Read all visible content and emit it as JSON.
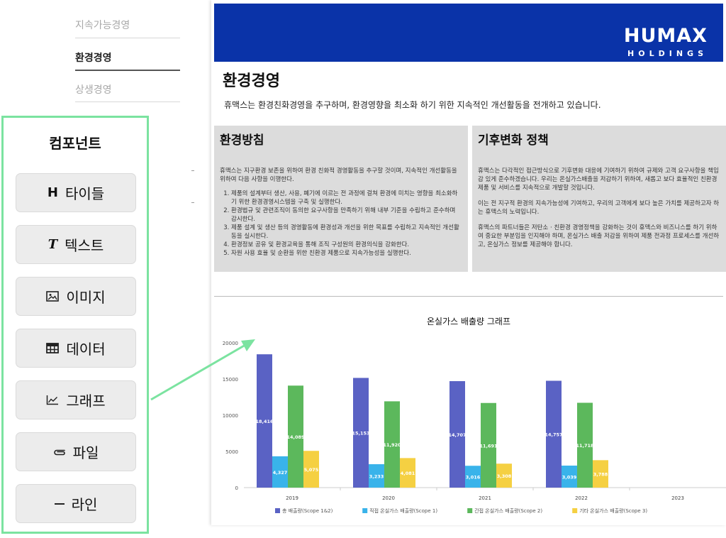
{
  "nav": {
    "items": [
      {
        "label": "지속가능경영",
        "active": false
      },
      {
        "label": "환경경영",
        "active": true
      },
      {
        "label": "상생경영",
        "active": false
      }
    ]
  },
  "components": {
    "title": "컴포넌트",
    "buttons": [
      {
        "icon": "heading-icon",
        "glyph": "H",
        "label": "타이들"
      },
      {
        "icon": "text-icon",
        "glyph": "T",
        "label": "텍스트"
      },
      {
        "icon": "image-icon",
        "glyph": "",
        "label": "이미지"
      },
      {
        "icon": "table-icon",
        "glyph": "",
        "label": "데이터"
      },
      {
        "icon": "line-chart-icon",
        "glyph": "",
        "label": "그래프"
      },
      {
        "icon": "paperclip-icon",
        "glyph": "",
        "label": "파일"
      },
      {
        "icon": "minus-icon",
        "glyph": "—",
        "label": "라인"
      }
    ]
  },
  "doc": {
    "logo_main": "HUMAX",
    "logo_sub": "HOLDINGS",
    "title": "환경경영",
    "intro": "휴맥스는 환경친화경영을 추구하며, 환경영향을 최소화 하기 위한 지속적인 개선활동을 전개하고 있습니다.",
    "left_box": {
      "title": "환경방침",
      "lead": "휴맥스는 지구환경 보존을 위하여 환경 친화적 경영활동을 추구할 것이며, 지속적인 개선활동을 위하여 다음 사항을 이행한다.",
      "items": [
        "제품의 설계부터 생산, 사용, 폐기에 이르는 전 과정에 걸쳐 환경에 미치는 영향을 최소화하기 위한 환경경영시스템을 구축 및 실행한다.",
        "환경법규 및 관련조직이 동의한 요구사항을 만족하기 위해 내부 기준을 수립하고 준수하며 감시한다.",
        "제품 설계 및 생산 등의 경영활동에 환경성과 개선을 위한 목표를 수립하고 지속적인 개선활동을 실시한다.",
        "환경정보 공유 및 환경교육을 통해 조직 구성원의 환경의식을 강화한다.",
        "자원 사용 효율 및 순환을 위한 친환경 제품으로 지속가능성을 실행한다."
      ]
    },
    "right_box": {
      "title": "기후변화 정책",
      "p1": "휴맥스는 다각적인 접근방식으로 기후변화 대응에 기여하기 위하여 규제와 고객 요구사항을 책임감 있게 준수하겠습니다. 우리는 온실가스배출을 저감하기 위하여, 새롭고 보다 효율적인 친환경 제품 및 서비스를 지속적으로 개발할 것입니다.",
      "p2": "이는 전 지구적 환경의 지속가능성에 기여하고, 우리의 고객에게 보다 높은 가치를 제공하고자 하는 휴맥스의 노력입니다.",
      "p3": "휴맥스의 파트너들은 저탄소 · 친환경 경영정책을 강화하는 것이 휴맥스와 비즈니스를 하기 위하여 중요한 부분임을 인지해야 하며, 온실가스 배출 저감을 위하여 제품 전과정 프로세스를 개선하고, 온실가스 정보를 제공해야 합니다."
    }
  },
  "chart_data": {
    "type": "bar",
    "title": "온실가스 배출량 그래프",
    "categories": [
      "2019",
      "2020",
      "2021",
      "2022",
      "2023"
    ],
    "ylim": [
      0,
      20000
    ],
    "yticks": [
      0,
      5000,
      10000,
      15000,
      20000
    ],
    "grid": false,
    "legend": "bottom",
    "series": [
      {
        "name": "총 배출량(Scope 1&2)",
        "color": "#5a62c4",
        "values": [
          18416,
          15153,
          14707,
          14757,
          null
        ],
        "labels": [
          "18,416",
          "15,153",
          "14,707",
          "14,757",
          ""
        ]
      },
      {
        "name": "직접 온실가스 배출량(Scope 1)",
        "color": "#39b3ea",
        "values": [
          4327,
          3233,
          3016,
          3039,
          null
        ],
        "labels": [
          "4,327",
          "3,233",
          "3,016",
          "3,039",
          ""
        ]
      },
      {
        "name": "간접 온실가스 배출량(Scope 2)",
        "color": "#5cb85c",
        "values": [
          14089,
          11920,
          11691,
          11718,
          null
        ],
        "labels": [
          "14,089",
          "11,920",
          "11,691",
          "11,718",
          ""
        ]
      },
      {
        "name": "기타 온실가스 배출량(Scope 3)",
        "color": "#f5d042",
        "values": [
          5075,
          4081,
          3308,
          3788,
          null
        ],
        "labels": [
          "5,075",
          "4,081",
          "3,308",
          "3,788",
          ""
        ]
      }
    ]
  },
  "colors": {
    "panel_border": "#7be3a0",
    "banner": "#0a33a8",
    "arrow": "#7be3a0"
  }
}
